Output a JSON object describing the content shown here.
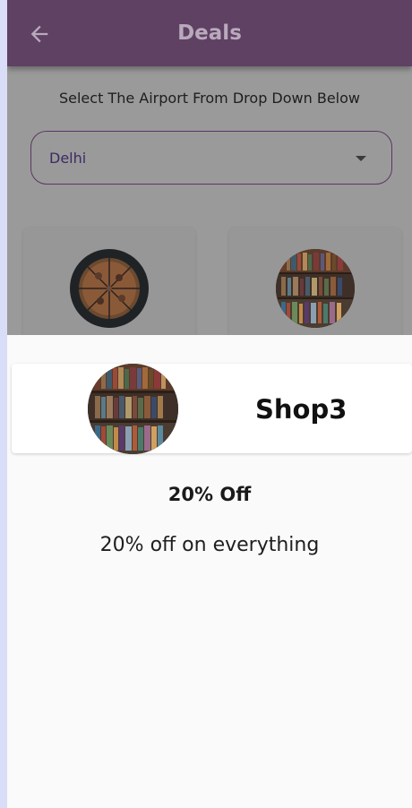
{
  "appbar": {
    "title": "Deals",
    "back_icon": "arrow-left-icon",
    "background": "#5e4163"
  },
  "airport_select": {
    "instruction": "Select The Airport From Drop Down Below",
    "selected_value": "Delhi",
    "caret_icon": "caret-down-icon"
  },
  "shop_cards": [
    {
      "thumb": "pizza-thumbnail"
    },
    {
      "thumb": "bookshelf-thumbnail"
    }
  ],
  "deal_sheet": {
    "shop_name": "Shop3",
    "thumb": "bookshelf-thumbnail",
    "deal_title": "20% Off",
    "deal_description": "20% off on everything"
  }
}
